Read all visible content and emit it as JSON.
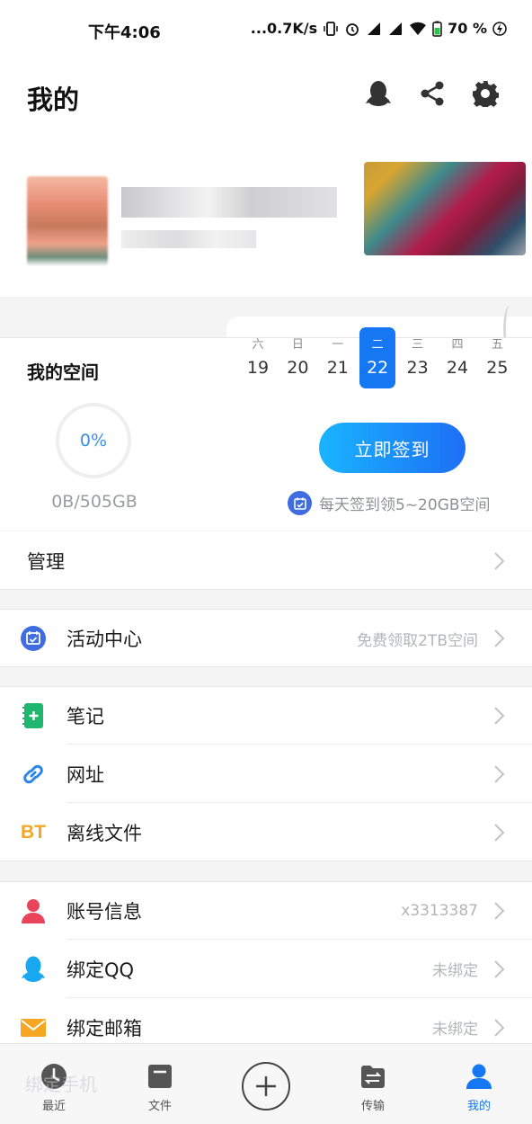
{
  "status_bar": {
    "time": "下午4:06",
    "net_speed": "...0.7K/s",
    "battery": "70",
    "battery_unit": "%"
  },
  "header": {
    "title": "我的",
    "icons": [
      "qq-penguin-icon",
      "share-icon",
      "settings-gear-icon"
    ]
  },
  "space": {
    "title": "我的空间",
    "percent": "0%",
    "storage": "0B/505GB",
    "checkin_label": "立即签到",
    "tip": "每天签到领5~20GB空间",
    "days": [
      {
        "weekday": "六",
        "date": "19"
      },
      {
        "weekday": "日",
        "date": "20"
      },
      {
        "weekday": "一",
        "date": "21"
      },
      {
        "weekday": "二",
        "date": "22"
      },
      {
        "weekday": "三",
        "date": "23"
      },
      {
        "weekday": "四",
        "date": "24"
      },
      {
        "weekday": "五",
        "date": "25"
      }
    ],
    "selected_day_index": 3
  },
  "manage": {
    "label": "管理"
  },
  "activity": {
    "label": "活动中心",
    "right": "免费领取2TB空间"
  },
  "tools": [
    {
      "label": "笔记",
      "icon": "note-icon"
    },
    {
      "label": "网址",
      "icon": "link-icon"
    },
    {
      "label": "离线文件",
      "icon": "bt-icon",
      "icon_text": "BT"
    }
  ],
  "account": [
    {
      "label": "账号信息",
      "right": "x3313387",
      "icon": "user-icon"
    },
    {
      "label": "绑定QQ",
      "right": "未绑定",
      "icon": "qq-icon"
    },
    {
      "label": "绑定邮箱",
      "right": "未绑定",
      "icon": "mail-icon"
    }
  ],
  "ghost_row": "绑定手机",
  "nav": {
    "items": [
      {
        "label": "最近",
        "icon": "clock-icon"
      },
      {
        "label": "文件",
        "icon": "folder-icon"
      },
      {
        "label": "传输",
        "icon": "transfer-icon"
      },
      {
        "label": "我的",
        "icon": "person-icon"
      }
    ],
    "active_index": 3
  },
  "colors": {
    "accent": "#1677f2",
    "bt_orange": "#f5a623",
    "note_green": "#1fb66e",
    "user_red": "#e8455b",
    "qq_blue": "#17a8f0",
    "mail_orange": "#f5a623"
  }
}
